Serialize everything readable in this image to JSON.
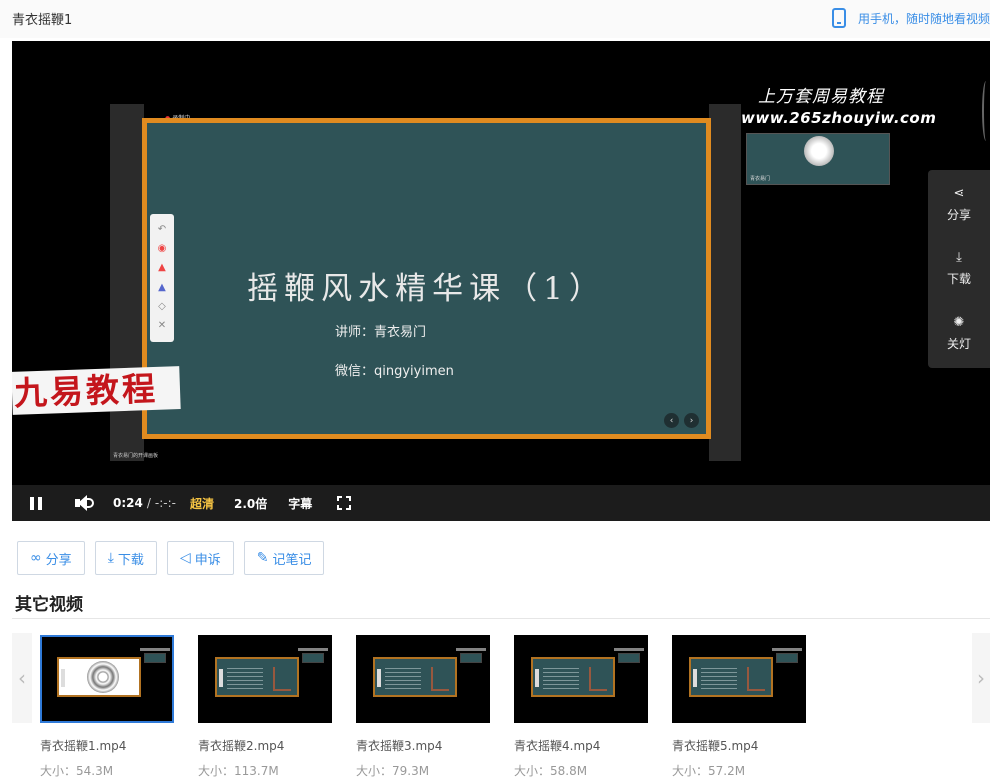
{
  "header": {
    "title": "青衣摇鞭1",
    "mobile_link": "用手机，随时随地看视频"
  },
  "player": {
    "board_title": "摇鞭风水精华课（1）",
    "lecturer": "讲师：青衣易门",
    "wechat": "微信：qingyiyimen",
    "recording_label": "录制中",
    "stamp_text": "九易教程",
    "watermark_cn": "上万套周易教程",
    "watermark_url": "www.265zhouyiw.com",
    "stand_caption": "青衣易门的开课画板",
    "mini_caption": "青衣易门",
    "controls": {
      "current_time": "0:24",
      "separator": "/",
      "duration": "-:-:-",
      "quality": "超清",
      "speed": "2.0倍",
      "subtitle": "字幕"
    },
    "side_panel": {
      "share": "分享",
      "download": "下载",
      "lights_off": "关灯"
    }
  },
  "actions": {
    "share": "分享",
    "download": "下载",
    "report": "申诉",
    "notes": "记笔记"
  },
  "other_videos": {
    "title": "其它视频",
    "items": [
      {
        "name": "青衣摇鞭1.mp4",
        "size": "大小：54.3M"
      },
      {
        "name": "青衣摇鞭2.mp4",
        "size": "大小：113.7M"
      },
      {
        "name": "青衣摇鞭3.mp4",
        "size": "大小：79.3M"
      },
      {
        "name": "青衣摇鞭4.mp4",
        "size": "大小：58.8M"
      },
      {
        "name": "青衣摇鞭5.mp4",
        "size": "大小：57.2M"
      }
    ]
  },
  "colors": {
    "accent": "#3a8ee6",
    "quality_highlight": "#f5c343",
    "board": "#2f5357",
    "board_frame": "#e08b20",
    "stamp_red": "#c4161c"
  }
}
